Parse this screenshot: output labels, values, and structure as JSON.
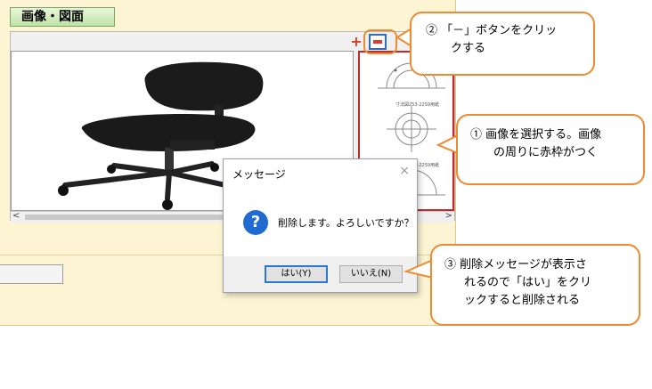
{
  "panel": {
    "title": "画像・図面"
  },
  "toolbar": {
    "add_symbol": "+"
  },
  "dialog": {
    "title": "メッセージ",
    "close": "×",
    "icon_symbol": "?",
    "message": "削除します。よろしいですか？",
    "yes_label": "はい(Y)",
    "no_label": "いいえ(N)"
  },
  "scrollbar": {
    "left": "<",
    "right": ">"
  },
  "callouts": {
    "step1_line1": "① 画像を選択する。画像",
    "step1_line2": "の周りに赤枠がつく",
    "step2_line1": "② 「－」ボタンをクリッ",
    "step2_line2": "クする",
    "step3_line1": "③ 削除メッセージが表示さ",
    "step3_line2": "れるので「はい」をクリ",
    "step3_line3": "ックすると削除される"
  },
  "thumbnail_labels": [
    "寸法図253-2259用紙",
    "寸法図253-2259用紙"
  ],
  "colors": {
    "accent": "#ee8a32",
    "selected_border": "#c62828",
    "primary_button": "#2a78d4"
  }
}
